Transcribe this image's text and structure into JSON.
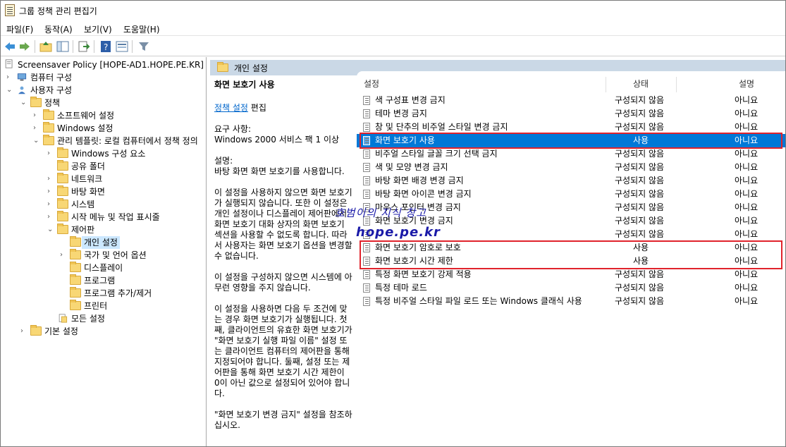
{
  "window": {
    "title": "그룹 정책 관리 편집기"
  },
  "menu": [
    "파일(F)",
    "동작(A)",
    "보기(V)",
    "도움말(H)"
  ],
  "toolbar": {
    "buttons": [
      "back-icon",
      "forward-icon",
      "up-folder-icon",
      "show-hide-tree-icon",
      "export-list-icon",
      "help-icon",
      "properties-icon",
      "filter-icon"
    ]
  },
  "tree": {
    "root": "Screensaver Policy [HOPE-AD1.HOPE.PE.KR] 정책",
    "items": [
      {
        "label": "컴퓨터 구성"
      },
      {
        "label": "사용자 구성"
      },
      {
        "label": "정책"
      },
      {
        "label": "소프트웨어 설정"
      },
      {
        "label": "Windows 설정"
      },
      {
        "label": "관리 템플릿: 로컬 컴퓨터에서 정책 정의"
      },
      {
        "label": "Windows 구성 요소"
      },
      {
        "label": "공유 폴더"
      },
      {
        "label": "네트워크"
      },
      {
        "label": "바탕 화면"
      },
      {
        "label": "시스템"
      },
      {
        "label": "시작 메뉴 및 작업 표시줄"
      },
      {
        "label": "제어판"
      },
      {
        "label": "개인 설정"
      },
      {
        "label": "국가 및 언어 옵션"
      },
      {
        "label": "디스플레이"
      },
      {
        "label": "프로그램"
      },
      {
        "label": "프로그램 추가/제거"
      },
      {
        "label": "프린터"
      },
      {
        "label": "모든 설정"
      },
      {
        "label": "기본 설정"
      }
    ]
  },
  "header": {
    "title": "개인 설정"
  },
  "description": {
    "title": "화면 보호기 사용",
    "link": "정책 설정",
    "link_suffix": " 편집",
    "req_label": "요구 사항:",
    "req_value": "Windows 2000 서비스 팩 1 이상",
    "desc_label": "설명:",
    "p1": "바탕 화면 화면 보호기를 사용합니다.",
    "p2": "이 설정을 사용하지 않으면 화면 보호기가 실행되지 않습니다. 또한 이 설정은 개인 설정이나 디스플레이 제어판에서 화면 보호기 대화 상자의 화면 보호기 섹션을 사용할 수 없도록 합니다. 따라서 사용자는 화면 보호기 옵션을 변경할 수 없습니다.",
    "p3": "이 설정을 구성하지 않으면 시스템에 아무런 영향을 주지 않습니다.",
    "p4": "이 설정을 사용하면 다음 두 조건에 맞는 경우 화면 보호기가 실행됩니다. 첫째, 클라이언트의 유효한 화면 보호기가 \"화면 보호기 실행 파일 이름\" 설정 또는 클라이언트 컴퓨터의 제어판을 통해 지정되어야 합니다. 둘째, 설정 또는 제어판을 통해 화면 보호기 시간 제한이 0이 아닌 값으로 설정되어 있어야 합니다.",
    "p5": "\"화면 보호기 변경 금지\" 설정을 참조하십시오."
  },
  "list": {
    "columns": {
      "setting": "설정",
      "state": "상태",
      "comment": "설명"
    },
    "rows": [
      {
        "name": "색 구성표 변경 금지",
        "state": "구성되지 않음",
        "comment": "아니요"
      },
      {
        "name": "테마 변경 금지",
        "state": "구성되지 않음",
        "comment": "아니요"
      },
      {
        "name": "창 및 단추의 비주얼 스타일 변경 금지",
        "state": "구성되지 않음",
        "comment": "아니요"
      },
      {
        "name": "화면 보호기 사용",
        "state": "사용",
        "comment": "아니요"
      },
      {
        "name": "비주얼 스타일 글꼴 크기 선택 금지",
        "state": "구성되지 않음",
        "comment": "아니요"
      },
      {
        "name": "색 및 모양 변경 금지",
        "state": "구성되지 않음",
        "comment": "아니요"
      },
      {
        "name": "바탕 화면 배경 변경 금지",
        "state": "구성되지 않음",
        "comment": "아니요"
      },
      {
        "name": "바탕 화면 아이콘 변경 금지",
        "state": "구성되지 않음",
        "comment": "아니요"
      },
      {
        "name": "마우스 포인터 변경 금지",
        "state": "구성되지 않음",
        "comment": "아니요"
      },
      {
        "name": "화면 보호기 변경 금지",
        "state": "구성되지 않음",
        "comment": "아니요"
      },
      {
        "name": "",
        "state": "구성되지 않음",
        "comment": "아니요"
      },
      {
        "name": "화면 보호기 암호로 보호",
        "state": "사용",
        "comment": "아니요"
      },
      {
        "name": "화면 보호기 시간 제한",
        "state": "사용",
        "comment": "아니요"
      },
      {
        "name": "특정 화면 보호기 강제 적용",
        "state": "구성되지 않음",
        "comment": "아니요"
      },
      {
        "name": "특정 테마 로드",
        "state": "구성되지 않음",
        "comment": "아니요"
      },
      {
        "name": "특정 비주얼 스타일 파일 로드 또는 Windows 클래식 사용",
        "state": "구성되지 않음",
        "comment": "아니요"
      }
    ]
  },
  "watermark": {
    "line1": "호범이의 지식 창고",
    "line2": "hope.pe.kr"
  },
  "colors": {
    "selection": "#0078d7",
    "highlight_box": "#e0232c",
    "header_band": "#cad8e6",
    "link": "#0066cc"
  }
}
